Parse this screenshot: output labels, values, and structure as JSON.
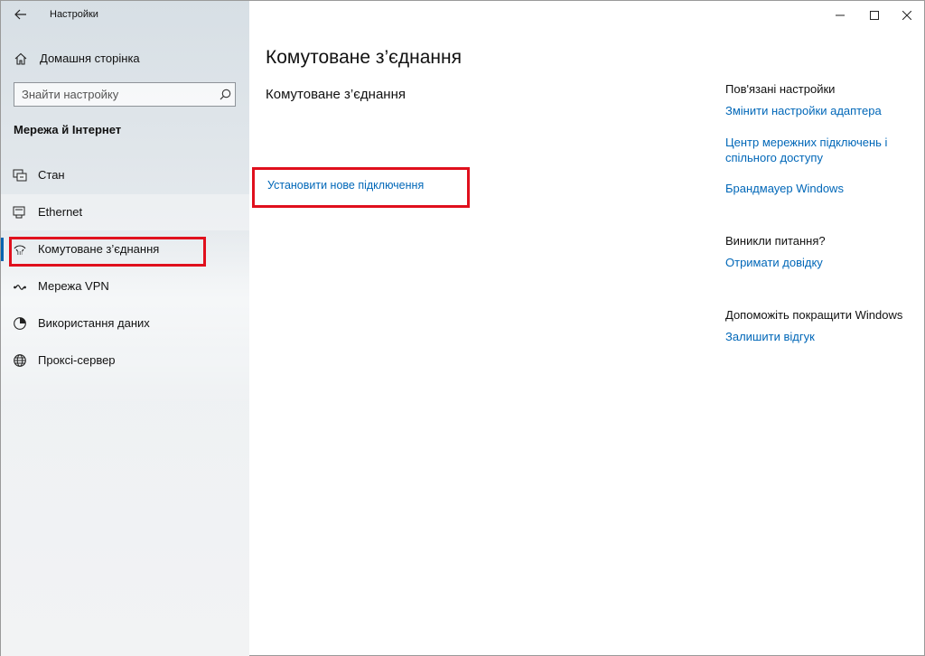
{
  "window": {
    "title": "Настройки",
    "controls": [
      "minimize-icon",
      "maximize-icon",
      "close-icon"
    ]
  },
  "sidebar": {
    "home_label": "Домашня сторінка",
    "search": {
      "placeholder": "Знайти настройку"
    },
    "section_title": "Мережа й Інтернет",
    "items": [
      {
        "label": "Стан",
        "icon": "status-icon"
      },
      {
        "label": "Ethernet",
        "icon": "ethernet-icon"
      },
      {
        "label": "Комутоване з’єднання",
        "icon": "dialup-icon",
        "selected": true
      },
      {
        "label": "Мережа VPN",
        "icon": "vpn-icon"
      },
      {
        "label": "Використання даних",
        "icon": "data-usage-icon"
      },
      {
        "label": "Проксі-сервер",
        "icon": "globe-icon"
      }
    ]
  },
  "main": {
    "title": "Комутоване з’єднання",
    "subtitle": "Комутоване з’єднання",
    "setup_link": "Установити нове підключення"
  },
  "related": {
    "heading": "Пов'язані настройки",
    "links": [
      "Змінити настройки адаптера",
      "Центр мережних підключень і спільного доступу",
      "Брандмауер Windows"
    ],
    "questions_heading": "Виникли питання?",
    "help_link": "Отримати довідку",
    "improve_heading": "Допоможіть покращити Windows",
    "feedback_link": "Залишити відгук"
  },
  "colors": {
    "accent": "#0063b1",
    "link": "#0067b8",
    "highlight_box": "#e0101d"
  }
}
